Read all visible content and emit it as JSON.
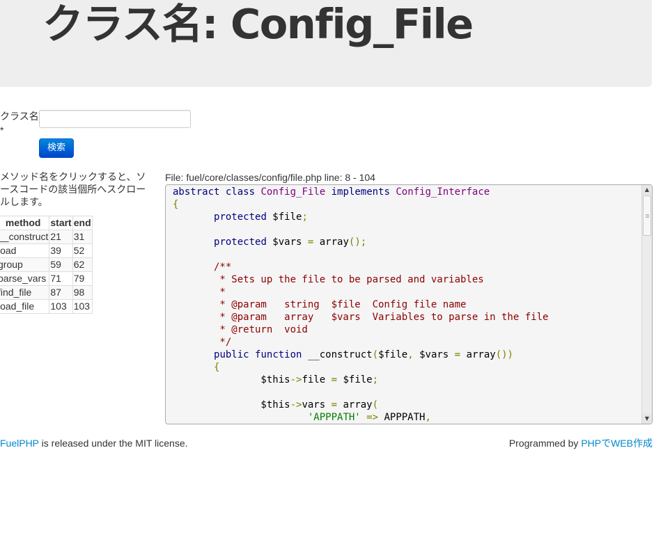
{
  "page": {
    "title": "クラス名: Config_File"
  },
  "search": {
    "label": "クラス名",
    "required_mark": "*",
    "input_value": "",
    "button_label": "検索"
  },
  "methods_panel": {
    "help_text": "メソッド名をクリックすると、ソースコードの該当個所へスクロールします。",
    "headers": [
      "method",
      "start",
      "end"
    ],
    "rows": [
      {
        "name": "__construct",
        "start": "21",
        "end": "31"
      },
      {
        "name": "load",
        "start": "39",
        "end": "52"
      },
      {
        "name": "group",
        "start": "59",
        "end": "62"
      },
      {
        "name": "parse_vars",
        "start": "71",
        "end": "79"
      },
      {
        "name": "find_file",
        "start": "87",
        "end": "98"
      },
      {
        "name": "load_file",
        "start": "103",
        "end": "103"
      }
    ]
  },
  "source": {
    "file_info": "File: fuel/core/classes/config/file.php line: 8 - 104",
    "lines": [
      [
        {
          "t": "abstract",
          "c": "kw"
        },
        {
          "t": " "
        },
        {
          "t": "class",
          "c": "kw"
        },
        {
          "t": " "
        },
        {
          "t": "Config_File",
          "c": "cls"
        },
        {
          "t": " "
        },
        {
          "t": "implements",
          "c": "kw"
        },
        {
          "t": " "
        },
        {
          "t": "Config_Interface",
          "c": "cls"
        }
      ],
      [
        {
          "t": "{",
          "c": "op"
        }
      ],
      [
        {
          "t": "       "
        },
        {
          "t": "protected",
          "c": "kw"
        },
        {
          "t": " $file"
        },
        {
          "t": ";",
          "c": "op"
        }
      ],
      [],
      [
        {
          "t": "       "
        },
        {
          "t": "protected",
          "c": "kw"
        },
        {
          "t": " $vars "
        },
        {
          "t": "=",
          "c": "op"
        },
        {
          "t": " array"
        },
        {
          "t": "();",
          "c": "op"
        }
      ],
      [],
      [
        {
          "t": "       /**",
          "c": "cmt"
        }
      ],
      [
        {
          "t": "        * Sets up the file to be parsed and variables",
          "c": "cmt"
        }
      ],
      [
        {
          "t": "        *",
          "c": "cmt"
        }
      ],
      [
        {
          "t": "        * @param   string  $file  Config file name",
          "c": "cmt"
        }
      ],
      [
        {
          "t": "        * @param   array   $vars  Variables to parse in the file",
          "c": "cmt"
        }
      ],
      [
        {
          "t": "        * @return  void",
          "c": "cmt"
        }
      ],
      [
        {
          "t": "        */",
          "c": "cmt"
        }
      ],
      [
        {
          "t": "       "
        },
        {
          "t": "public",
          "c": "kw"
        },
        {
          "t": " "
        },
        {
          "t": "function",
          "c": "kw"
        },
        {
          "t": " __construct"
        },
        {
          "t": "(",
          "c": "op"
        },
        {
          "t": "$file"
        },
        {
          "t": ",",
          "c": "op"
        },
        {
          "t": " $vars "
        },
        {
          "t": "=",
          "c": "op"
        },
        {
          "t": " array"
        },
        {
          "t": "())",
          "c": "op"
        }
      ],
      [
        {
          "t": "       "
        },
        {
          "t": "{",
          "c": "op"
        }
      ],
      [
        {
          "t": "               $this"
        },
        {
          "t": "->",
          "c": "op"
        },
        {
          "t": "file "
        },
        {
          "t": "=",
          "c": "op"
        },
        {
          "t": " $file"
        },
        {
          "t": ";",
          "c": "op"
        }
      ],
      [],
      [
        {
          "t": "               $this"
        },
        {
          "t": "->",
          "c": "op"
        },
        {
          "t": "vars "
        },
        {
          "t": "=",
          "c": "op"
        },
        {
          "t": " array"
        },
        {
          "t": "(",
          "c": "op"
        }
      ],
      [
        {
          "t": "                       "
        },
        {
          "t": "'APPPATH'",
          "c": "str"
        },
        {
          "t": " "
        },
        {
          "t": "=>",
          "c": "op"
        },
        {
          "t": " APPPATH"
        },
        {
          "t": ",",
          "c": "op"
        }
      ]
    ]
  },
  "footer": {
    "left_link": "FuelPHP",
    "left_text": " is released under the MIT license.",
    "right_text": "Programmed by ",
    "right_link": "PHPでWEB作成"
  }
}
